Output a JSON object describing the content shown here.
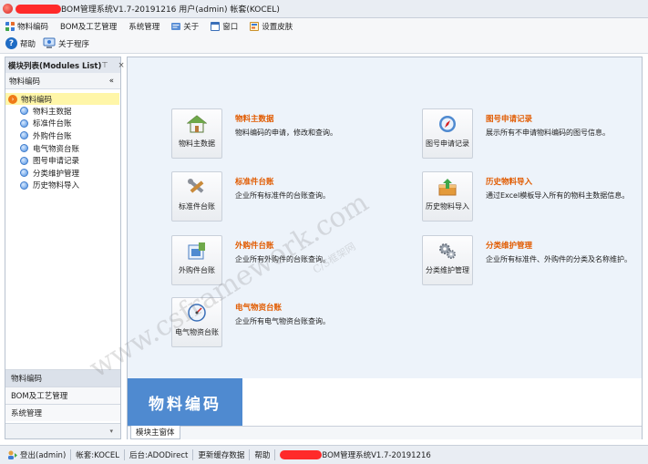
{
  "window": {
    "title": "BOM管理系统V1.7-20191216 用户(admin) 帐套(KOCEL)"
  },
  "menubar": {
    "items": [
      {
        "label": "物料编码",
        "icon": "grid-icon"
      },
      {
        "label": "BOM及工艺管理",
        "icon": ""
      },
      {
        "label": "系统管理",
        "icon": ""
      },
      {
        "label": "关于",
        "icon": "about-icon"
      },
      {
        "label": "窗口",
        "icon": "window-icon"
      },
      {
        "label": "设置皮肤",
        "icon": "skin-icon"
      }
    ]
  },
  "toolbar": {
    "help_label": "帮助",
    "about_label": "关于程序"
  },
  "left_panel": {
    "title": "模块列表(Modules List)",
    "controls": "⊤ ×",
    "subheader": "物料编码",
    "collapse": "«",
    "tree_root": "物料编码",
    "tree_items": [
      "物料主数据",
      "标准件台账",
      "外购件台账",
      "电气物资台账",
      "图号申请记录",
      "分类维护管理",
      "历史物料导入"
    ],
    "sections": [
      "物料编码",
      "BOM及工艺管理",
      "系统管理"
    ],
    "bottom_arrow": "▾"
  },
  "main": {
    "cards": [
      {
        "tile_label": "物料主数据",
        "title": "物料主数据",
        "desc": "物料编码的申请，修改和查询。",
        "icon": "house-icon"
      },
      {
        "tile_label": "标准件台账",
        "title": "标准件台账",
        "desc": "企业所有标准件的台账查询。",
        "icon": "tools-icon"
      },
      {
        "tile_label": "外购件台账",
        "title": "外购件台账",
        "desc": "企业所有外购件的台账查询。",
        "icon": "purchase-icon"
      },
      {
        "tile_label": "电气物资台账",
        "title": "电气物资台账",
        "desc": "企业所有电气物资台账查询。",
        "icon": "gauge-icon"
      },
      {
        "tile_label": "图号申请记录",
        "title": "图号申请记录",
        "desc": "展示所有不申请物料编码的图号信息。",
        "icon": "compass-icon"
      },
      {
        "tile_label": "历史物料导入",
        "title": "历史物料导入",
        "desc": "通过Excel模板导入所有的物料主数据信息。",
        "icon": "import-icon"
      },
      {
        "tile_label": "分类维护管理",
        "title": "分类维护管理",
        "desc": "企业所有标准件、外购件的分类及名称维护。",
        "icon": "gears-icon"
      }
    ],
    "banner": "物料编码",
    "tab": "模块主窗体"
  },
  "watermark": {
    "line1": "www.csframework.com",
    "line2": "C/S框架网"
  },
  "statusbar": {
    "items": [
      "登出(admin)",
      "帐套:KOCEL",
      "后台:ADODirect",
      "更新缓存数据",
      "帮助",
      "BOM管理系统V1.7-20191216"
    ]
  },
  "colors": {
    "accent_orange": "#e15b00",
    "banner_blue": "#4f8ad0",
    "tree_highlight": "#fff6a8",
    "redaction_red": "#ff2a2a"
  }
}
